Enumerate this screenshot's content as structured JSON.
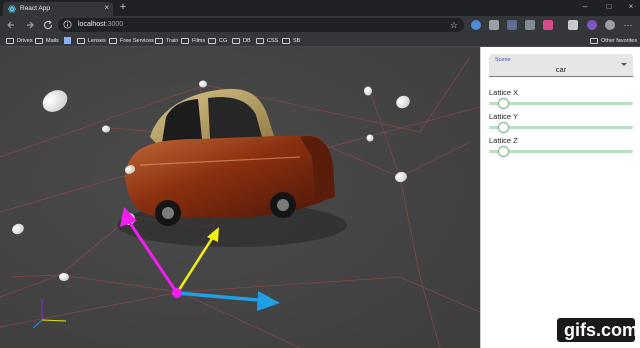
{
  "browser": {
    "tab_title": "React App",
    "new_tab": "+",
    "tab_close": "×",
    "window_controls": {
      "minimize": "–",
      "maximize": "□",
      "close": "×"
    },
    "url_host": "localhost",
    "url_port": ":3000",
    "star": "☆",
    "bookmarks": [
      "Drives",
      "Mails",
      "Lenses",
      "Free Services",
      "Train",
      "Films",
      "CG",
      "DB",
      "CSS",
      "SB"
    ],
    "other_bookmarks": "Other favorites"
  },
  "panel": {
    "select_label": "Scene",
    "select_value": "car",
    "sliders": [
      {
        "label": "Lattice X",
        "value": 0.1
      },
      {
        "label": "Lattice Y",
        "value": 0.1
      },
      {
        "label": "Lattice Z",
        "value": 0.1
      }
    ]
  },
  "viewport": {
    "object": "car",
    "gizmo_colors": {
      "x": "#1fa0e6",
      "y": "#f2f20f",
      "z": "#f01ef0"
    },
    "background": "#454545",
    "lattice_line_color": "#b45050"
  },
  "watermark": "gifs.com"
}
